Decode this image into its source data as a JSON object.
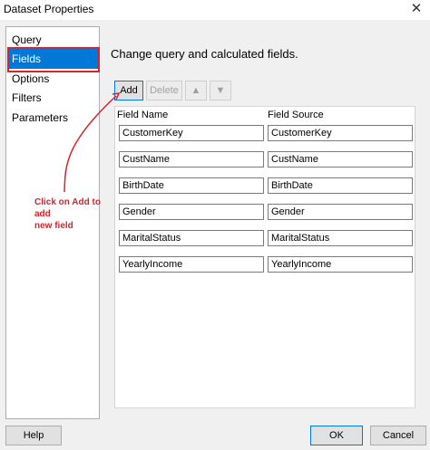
{
  "window": {
    "title": "Dataset Properties"
  },
  "sidebar": {
    "items": [
      {
        "label": "Query"
      },
      {
        "label": "Fields"
      },
      {
        "label": "Options"
      },
      {
        "label": "Filters"
      },
      {
        "label": "Parameters"
      }
    ],
    "selected": "Fields"
  },
  "main": {
    "heading": "Change query and calculated fields.",
    "toolbar": {
      "add_label": "Add",
      "delete_label": "Delete"
    },
    "columns": {
      "field_name": "Field Name",
      "field_source": "Field Source"
    },
    "fields": [
      {
        "name": "CustomerKey",
        "source": "CustomerKey"
      },
      {
        "name": "CustName",
        "source": "CustName"
      },
      {
        "name": "BirthDate",
        "source": "BirthDate"
      },
      {
        "name": "Gender",
        "source": "Gender"
      },
      {
        "name": "MaritalStatus",
        "source": "MaritalStatus"
      },
      {
        "name": "YearlyIncome",
        "source": "YearlyIncome"
      }
    ]
  },
  "annotation": {
    "line1": "Click on Add to add",
    "line2": "new field"
  },
  "footer": {
    "help_label": "Help",
    "ok_label": "OK",
    "cancel_label": "Cancel"
  },
  "colors": {
    "accent": "#0078d7",
    "annotation": "#d9232a"
  },
  "icons": {
    "close": "close-icon",
    "move_up": "arrow-up-icon",
    "move_down": "arrow-down-icon"
  }
}
